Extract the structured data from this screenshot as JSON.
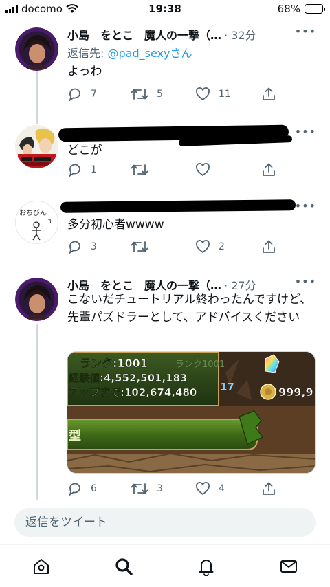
{
  "status_bar": {
    "carrier": "docomo",
    "time": "19:38",
    "battery": "68%",
    "battery_level": 0.68
  },
  "tweets": [
    {
      "name": "小島　をとこ　魔人の一撃（…",
      "time": "· 32分",
      "reply_to_prefix": "返信先: ",
      "reply_to_handle": "@pad_sexy",
      "reply_to_suffix": "さん",
      "text": "よっわ",
      "replies": "7",
      "retweets": "5",
      "likes": "11"
    },
    {
      "name": "",
      "text": "どこが",
      "replies": "1",
      "retweets": "",
      "likes": ""
    },
    {
      "name": "",
      "avatar_text": "おちびん",
      "avatar_text2": "3",
      "text": "多分初心者wwww",
      "replies": "3",
      "retweets": "",
      "likes": "2"
    },
    {
      "name": "小島　をとこ　魔人の一撃（…",
      "time": "· 27分",
      "text": "こないだチュートリアル終わったんですけど、先輩パズドラーとして、アドバイスください",
      "image": {
        "rank_label": "ランク:1001",
        "rank_ghost": "ランク1001",
        "exp_label": "経験値:4,552,501,183",
        "next_label": "アップまで:102,674,480",
        "coins": "999,9",
        "side_number": "17",
        "banner_char": "型"
      },
      "replies": "6",
      "retweets": "3",
      "likes": "4"
    }
  ],
  "compose": {
    "placeholder": "返信をツイート"
  },
  "tabbar": [
    "home-icon",
    "search-icon",
    "notifications-icon",
    "messages-icon"
  ],
  "colors": {
    "accent": "#1d9bf0",
    "secondary_text": "#536471",
    "thread_line": "#cfd9de"
  }
}
